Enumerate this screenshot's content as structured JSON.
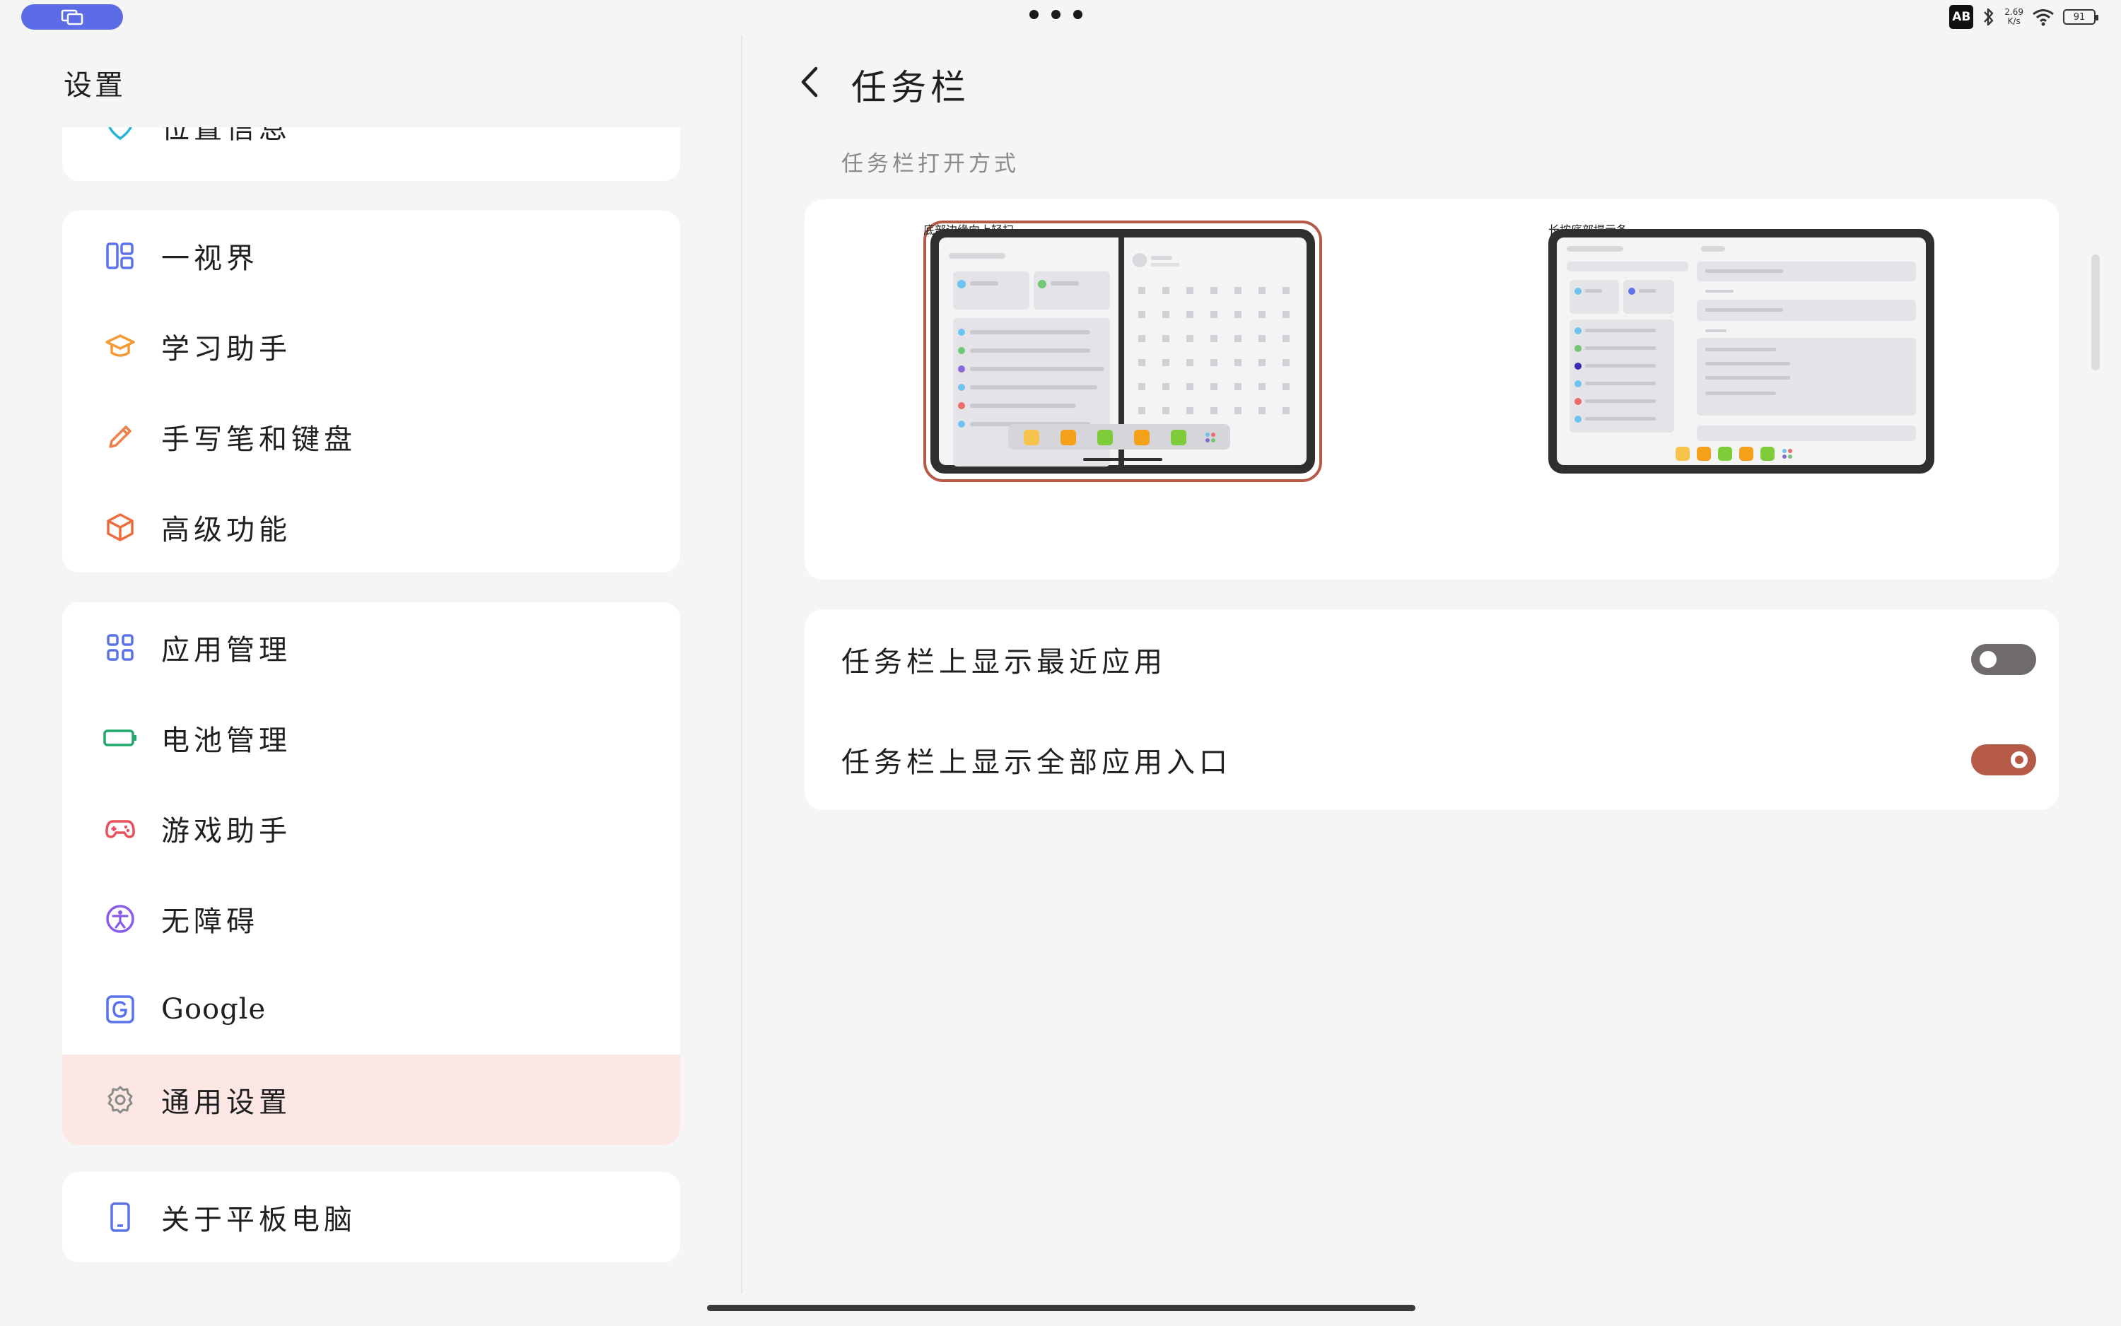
{
  "status_bar": {
    "input_badge": "AB",
    "net_speed_value": "2.69",
    "net_speed_unit": "K/s",
    "battery": "91"
  },
  "sidebar": {
    "title": "设置",
    "partial_item": {
      "label": "位置信息",
      "icon": "location-pin-icon"
    },
    "groups": [
      [
        {
          "label": "一视界",
          "icon": "split-view-icon"
        },
        {
          "label": "学习助手",
          "icon": "graduation-cap-icon"
        },
        {
          "label": "手写笔和键盘",
          "icon": "pencil-icon"
        },
        {
          "label": "高级功能",
          "icon": "cube-icon"
        }
      ],
      [
        {
          "label": "应用管理",
          "icon": "app-grid-icon"
        },
        {
          "label": "电池管理",
          "icon": "battery-icon"
        },
        {
          "label": "游戏助手",
          "icon": "gamepad-icon"
        },
        {
          "label": "无障碍",
          "icon": "accessibility-icon"
        },
        {
          "label": "Google",
          "icon": "google-icon"
        },
        {
          "label": "通用设置",
          "icon": "gear-icon",
          "active": true
        }
      ],
      [
        {
          "label": "关于平板电脑",
          "icon": "tablet-icon"
        }
      ]
    ]
  },
  "main": {
    "title": "任务栏",
    "section_label": "任务栏打开方式",
    "open_methods": [
      {
        "label": "底部边缘向上轻扫",
        "selected": true
      },
      {
        "label": "长按底部提示条",
        "selected": false
      }
    ],
    "toggles": [
      {
        "label": "任务栏上显示最近应用",
        "on": false
      },
      {
        "label": "任务栏上显示全部应用入口",
        "on": true
      }
    ]
  },
  "colors": {
    "accent": "#b45a46",
    "active_bg": "#fde7e4",
    "toggle_off": "#6f6b6a",
    "pill": "#5b6ce6"
  }
}
